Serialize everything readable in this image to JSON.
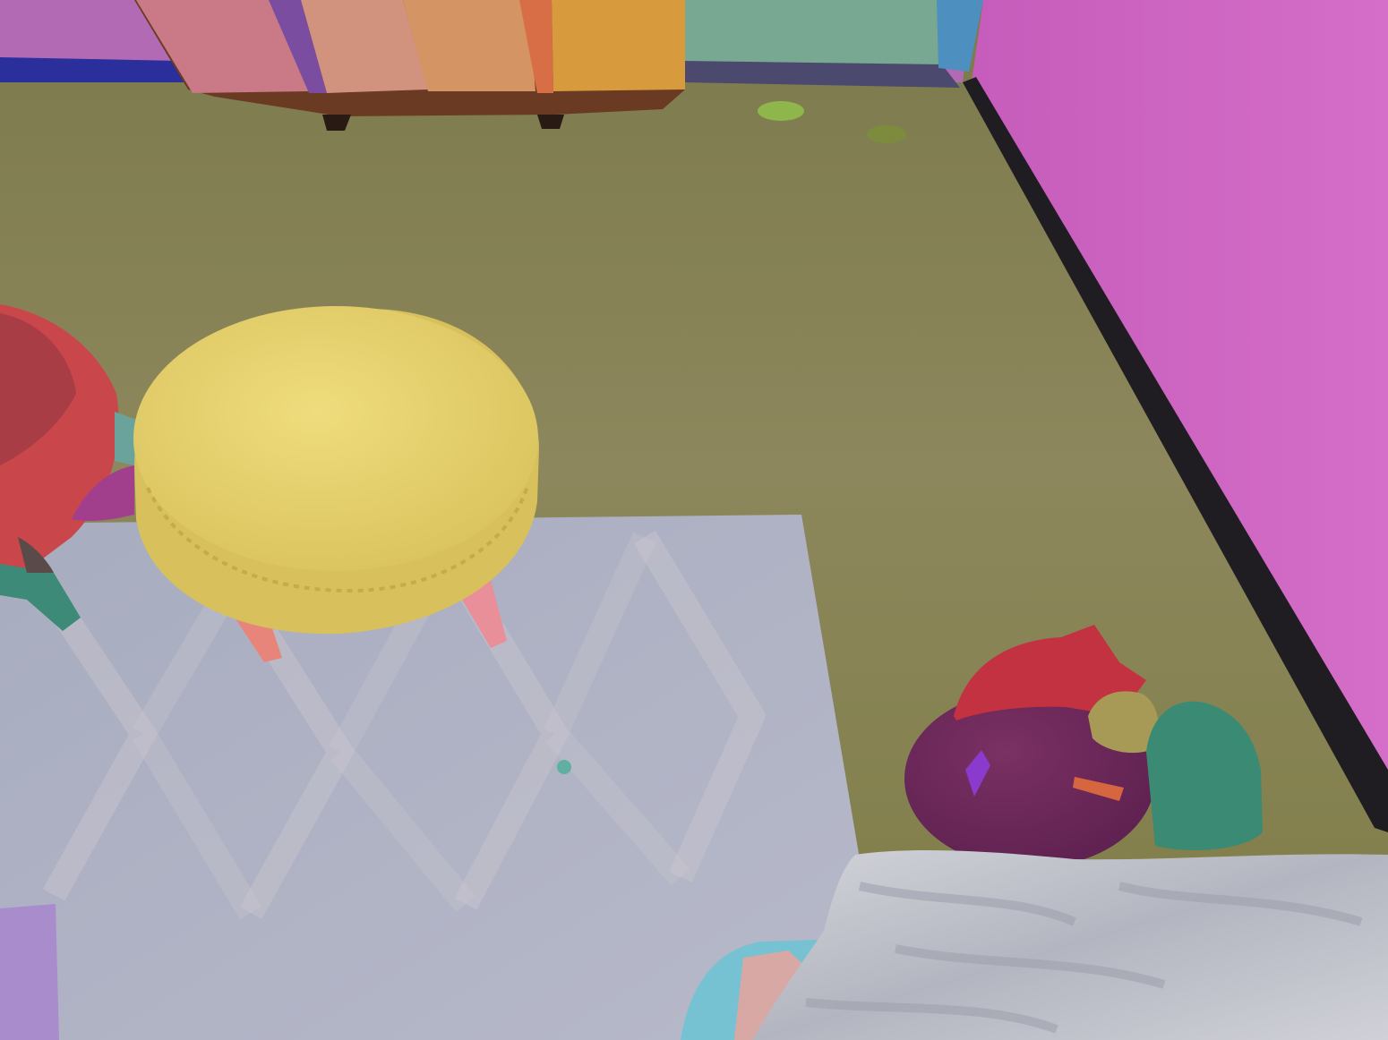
{
  "scene": {
    "kind": "segmented-room-render",
    "objects": [
      {
        "name": "back-wall",
        "color": "#b36ab5"
      },
      {
        "name": "right-wall",
        "color": "#d066c4"
      },
      {
        "name": "wall-baseboard",
        "color": "#1f1d22"
      },
      {
        "name": "carpet-floor",
        "color": "#8a8558"
      },
      {
        "name": "bookshelf",
        "color": "#c98a5a"
      },
      {
        "name": "cabinet-panel-teal",
        "color": "#78a892"
      },
      {
        "name": "doorframe-blue",
        "color": "#4d8fbf"
      },
      {
        "name": "area-rug",
        "color": "#aeb2c4"
      },
      {
        "name": "yellow-ottoman",
        "color": "#e3cf6a"
      },
      {
        "name": "red-chair",
        "color": "#c9474b"
      },
      {
        "name": "purple-bean-bag",
        "color": "#6e2a58"
      },
      {
        "name": "red-pillow",
        "color": "#c33240"
      },
      {
        "name": "green-pillow",
        "color": "#3a8a74"
      },
      {
        "name": "khaki-toy",
        "color": "#a79a57"
      },
      {
        "name": "grey-blanket",
        "color": "#c9cbd3"
      },
      {
        "name": "light-blue-object",
        "color": "#77c2d2"
      },
      {
        "name": "lavender-object",
        "color": "#a98ccc"
      },
      {
        "name": "green-floor-spot",
        "color": "#8fb64a"
      }
    ]
  }
}
